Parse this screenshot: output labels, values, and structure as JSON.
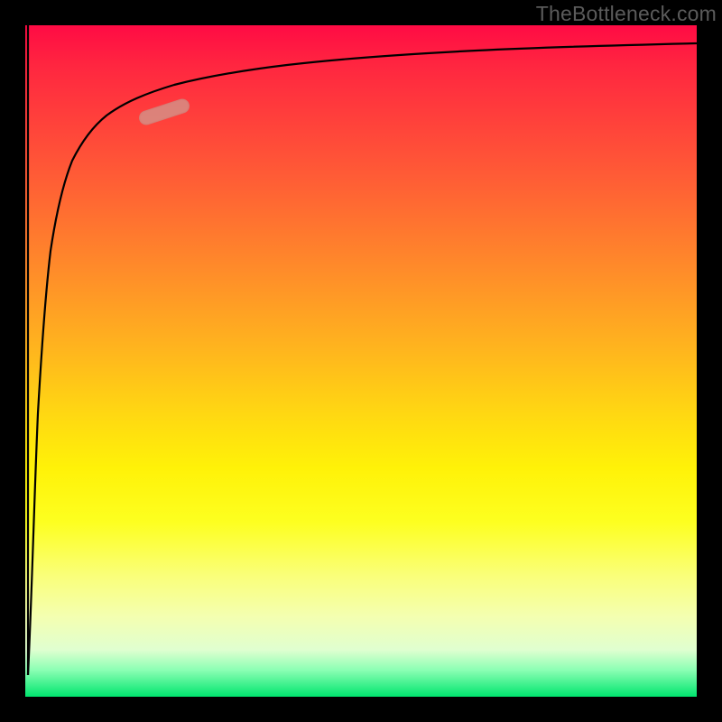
{
  "watermark": "TheBottleneck.com",
  "colors": {
    "frame": "#000000",
    "curve_stroke": "#000000",
    "highlight": "rgba(210,150,140,0.78)"
  },
  "chart_data": {
    "type": "line",
    "title": "",
    "xlabel": "",
    "ylabel": "",
    "xlim": [
      0,
      100
    ],
    "ylim": [
      0,
      100
    ],
    "grid": false,
    "legend": false,
    "series": [
      {
        "name": "curve",
        "x": [
          0.5,
          1.0,
          1.5,
          2.0,
          2.5,
          3.0,
          3.5,
          4.0,
          5.0,
          6.0,
          7.0,
          8.0,
          10.0,
          12.0,
          15.0,
          20.0,
          25.0,
          30.0,
          40.0,
          50.0,
          60.0,
          70.0,
          80.0,
          90.0,
          100.0
        ],
        "y": [
          3.0,
          20.0,
          38.0,
          50.0,
          58.0,
          64.0,
          68.0,
          71.0,
          75.5,
          78.5,
          80.5,
          82.0,
          84.5,
          86.0,
          87.8,
          89.8,
          91.2,
          92.2,
          93.6,
          94.6,
          95.3,
          95.9,
          96.3,
          96.7,
          97.0
        ]
      },
      {
        "name": "initial-drop",
        "x": [
          0.0,
          0.2,
          0.5
        ],
        "y": [
          100.0,
          50.0,
          3.0
        ]
      }
    ],
    "highlight_segment": {
      "x_range": [
        16,
        24
      ],
      "y_range": [
        86,
        90
      ]
    },
    "background_gradient": {
      "direction": "vertical",
      "stops": [
        {
          "pos": 0.0,
          "color": "#ff0b44"
        },
        {
          "pos": 0.22,
          "color": "#ff5a36"
        },
        {
          "pos": 0.48,
          "color": "#ffb41e"
        },
        {
          "pos": 0.66,
          "color": "#fff208"
        },
        {
          "pos": 0.88,
          "color": "#f4ffb0"
        },
        {
          "pos": 1.0,
          "color": "#00e56e"
        }
      ]
    }
  }
}
